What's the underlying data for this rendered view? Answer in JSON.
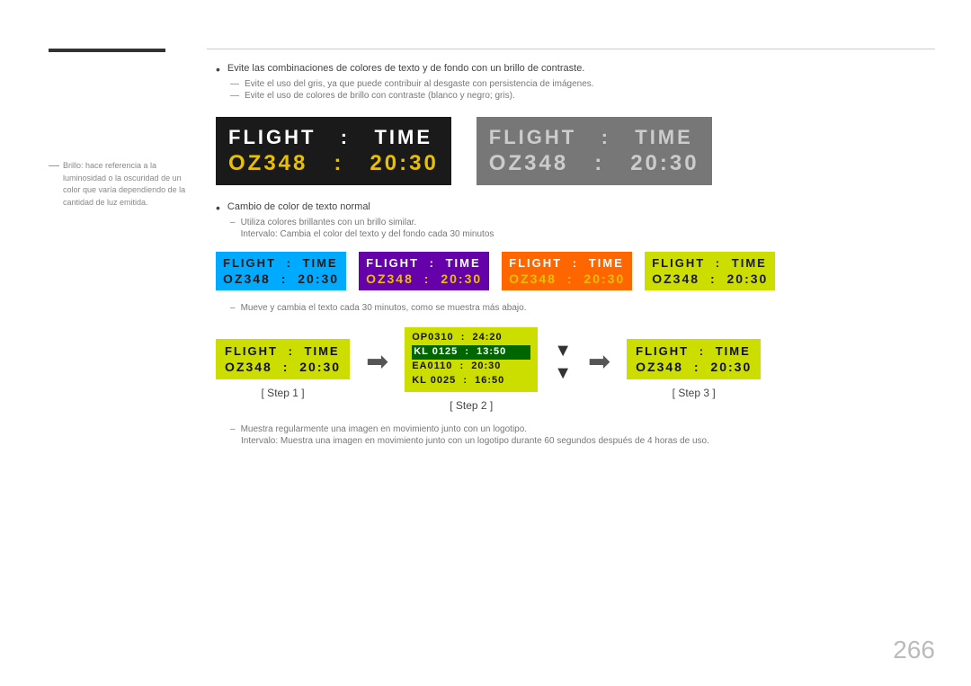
{
  "page": {
    "number": "266"
  },
  "sidebar": {
    "note_label": "—",
    "note_text": "Brillo: hace referencia a la luminosidad o la oscuridad de un color que varía dependiendo de la cantidad de luz emitida."
  },
  "bullets": {
    "b1": "Evite las combinaciones de colores de texto y de fondo con un brillo de contraste.",
    "d1": "Evite el uso del gris, ya que puede contribuir al desgaste con persistencia de imágenes.",
    "d2": "Evite el uso de colores de brillo con contraste (blanco y negro; gris).",
    "b2": "Cambio de color de texto normal",
    "d3": "Utiliza colores brillantes con un brillo similar.",
    "d4": "Intervalo: Cambia el color del texto y del fondo cada 30 minutos",
    "d5": "Mueve y cambia el texto cada 30 minutos, como se muestra más abajo.",
    "d6": "Muestra regularmente una imagen en movimiento junto con un logotipo.",
    "d7": "Intervalo: Muestra una imagen en movimiento junto con un logotipo durante 60 segundos después de 4 horas de uso."
  },
  "flight_labels": {
    "flight": "FLIGHT",
    "colon": ":",
    "time": "TIME",
    "oz348": "OZ348",
    "t2030": "20:30"
  },
  "boxes": {
    "dark": {
      "bg": "#1a1a1a",
      "label1_color": "#ffffff",
      "label2_color": "#e8c000"
    },
    "gray": {
      "bg": "#777777",
      "label1_color": "#cccccc",
      "label2_color": "#cccccc"
    },
    "blue": {
      "bg": "#00aaff",
      "label1_color": "#111111",
      "label2_color": "#111111"
    },
    "purple": {
      "bg": "#6600aa",
      "label1_color": "#ffffff",
      "label2_color": "#e8c000"
    },
    "orange": {
      "bg": "#ff6600",
      "label1_color": "#ffffff",
      "label2_color": "#e8c000"
    },
    "yellow": {
      "bg": "#ccdd00",
      "label1_color": "#111111",
      "label2_color": "#111111"
    }
  },
  "steps": {
    "step1": "[ Step 1 ]",
    "step2": "[ Step 2 ]",
    "step3": "[ Step 3 ]"
  },
  "step2_flights": [
    {
      "code": "OP0310",
      "time": "24:20"
    },
    {
      "code": "KL 0125",
      "time": "13:50"
    },
    {
      "code": "EA0110",
      "time": "20:30"
    },
    {
      "code": "KL 0025",
      "time": "16:50"
    }
  ]
}
